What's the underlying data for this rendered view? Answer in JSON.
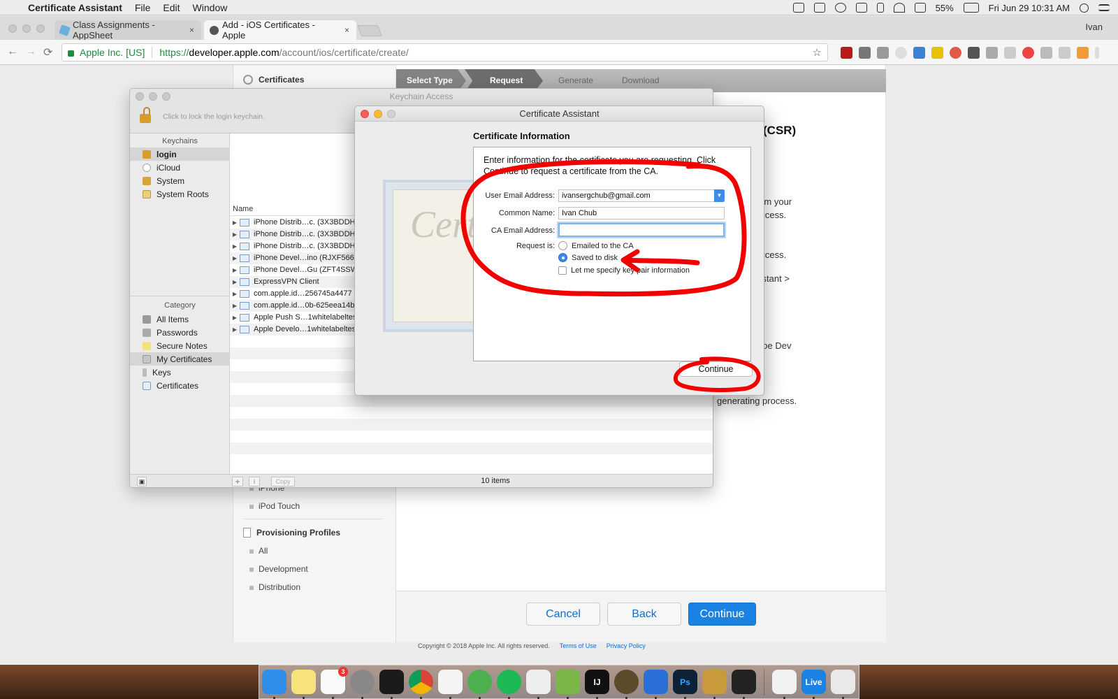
{
  "menubar": {
    "app_name": "Certificate Assistant",
    "menus": [
      "File",
      "Edit",
      "Window"
    ],
    "battery": "55%",
    "datetime": "Fri Jun 29  10:31 AM"
  },
  "browser": {
    "tabs": [
      {
        "title": "Class Assignments - AppSheet",
        "close": "×"
      },
      {
        "title": "Add - iOS Certificates - Apple",
        "close": "×"
      }
    ],
    "user": "Ivan",
    "org": "Apple Inc. [US]",
    "url_proto": "https://",
    "url_host": "developer.apple.com",
    "url_path": "/account/ios/certificate/create/",
    "nav_back": "←",
    "nav_forward": "→",
    "nav_reload": "⟳",
    "star": "☆",
    "colors": {
      "secure_green": "#1e8c3a",
      "link_blue": "#0b6fd1"
    }
  },
  "portal": {
    "sidebar": {
      "certificates_heading": "Certificates",
      "devices_items": [
        "iPhone",
        "iPod Touch"
      ],
      "profiles_heading": "Provisioning Profiles",
      "profiles_items": [
        "All",
        "Development",
        "Distribution"
      ]
    },
    "steps": [
      "Select Type",
      "Request",
      "Generate",
      "Download"
    ],
    "csr_title": "(CSR)",
    "text_fragments": [
      "SR) file from your",
      "eychain Access.",
      "eychain Access.",
      "ficate Assistant >",
      "g., John Doe Dev",
      "generating process."
    ],
    "buttons": {
      "cancel": "Cancel",
      "back": "Back",
      "continue": "Continue"
    },
    "footer": {
      "copyright": "Copyright © 2018 Apple Inc. All rights reserved.",
      "terms": "Terms of Use",
      "privacy": "Privacy Policy"
    }
  },
  "keychain": {
    "title": "Keychain Access",
    "lock_text": "Click to lock the login keychain.",
    "keychains_header": "Keychains",
    "keychains": [
      "login",
      "iCloud",
      "System",
      "System Roots"
    ],
    "category_header": "Category",
    "categories": [
      "All Items",
      "Passwords",
      "Secure Notes",
      "My Certificates",
      "Keys",
      "Certificates"
    ],
    "name_header": "Name",
    "rows": [
      "iPhone Distrib…c. (3X3BDDH",
      "iPhone Distrib…c. (3X3BDDH",
      "iPhone Distrib…c. (3X3BDDH",
      "iPhone Devel…ino (RJXF566",
      "iPhone Devel…Gu (ZFT4SSW",
      "ExpressVPN Client",
      "com.apple.id…256745a4477",
      "com.apple.id…0b-625eea14b",
      "Apple Push S…1whitelabeltes",
      "Apple Develo…1whitelabeltes"
    ],
    "copy_button": "Copy",
    "add_button": "+",
    "info_button": "i",
    "item_count": "10 items"
  },
  "cert_assistant": {
    "title": "Certificate Assistant",
    "heading": "Certificate Information",
    "background_word": "Certificate",
    "intro": "Enter information for the certificate you are requesting. Click Continue to request a certificate from the CA.",
    "labels": {
      "email": "User Email Address:",
      "common_name": "Common Name:",
      "ca_email": "CA Email Address:",
      "request_is": "Request is:"
    },
    "values": {
      "email": "ivansergchub@gmail.com",
      "common_name": "Ivan Chub",
      "ca_email": ""
    },
    "options": {
      "emailed": "Emailed to the CA",
      "saved": "Saved to disk",
      "specify_keypair": "Let me specify key pair information"
    },
    "selected_option": "Saved to disk",
    "continue": "Continue"
  },
  "dock": {
    "apps": [
      "finder-icon",
      "notes-icon",
      "reminders-icon",
      "system-preferences-icon",
      "terminal-icon",
      "chrome-icon",
      "textedit-icon",
      "android-studio-icon",
      "spotify-icon",
      "skitch-icon",
      "sketch-icon",
      "intellij-icon",
      "instruments-icon",
      "creative-cloud-icon",
      "photoshop-icon",
      "keychain-icon",
      "bartender-icon",
      "itunes-icon",
      "live-icon",
      "trash-icon"
    ],
    "ps_label": "Ps",
    "ij_label": "IJ",
    "live_label": "Live",
    "reminders_badge": "3"
  }
}
